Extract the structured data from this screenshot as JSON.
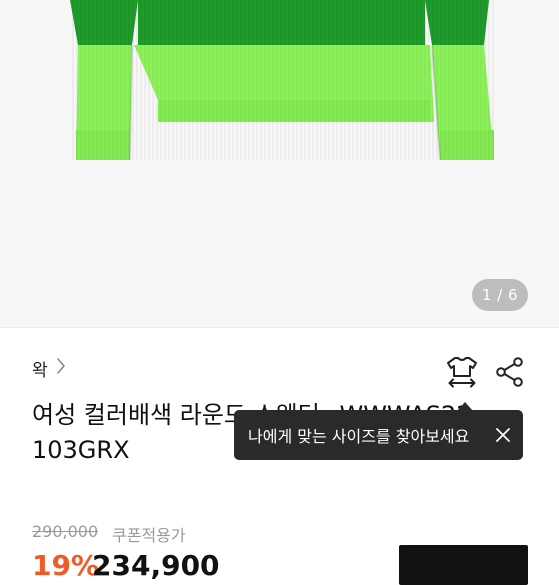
{
  "gallery": {
    "page_indicator": "1 / 6"
  },
  "product": {
    "brand": "왁",
    "title": "여성 컬러배색 라운드 스웨터 _WWWAS22103GRX",
    "original_price": "290,000",
    "coupon_label": "쿠폰적용가",
    "discount_rate": "19%",
    "sale_price": "234,900"
  },
  "tooltip": {
    "text": "나에게 맞는 사이즈를 찾아보세요"
  },
  "icons": {
    "size": "shirt-size-icon",
    "share": "share-icon",
    "close": "close-icon",
    "chevron": "chevron-right-icon"
  },
  "colors": {
    "sweater_dark_green": "#1e9b2a",
    "sweater_neon_green": "#8cf25a",
    "tooltip_bg": "#2a2a2a",
    "discount": "#f15a24"
  }
}
